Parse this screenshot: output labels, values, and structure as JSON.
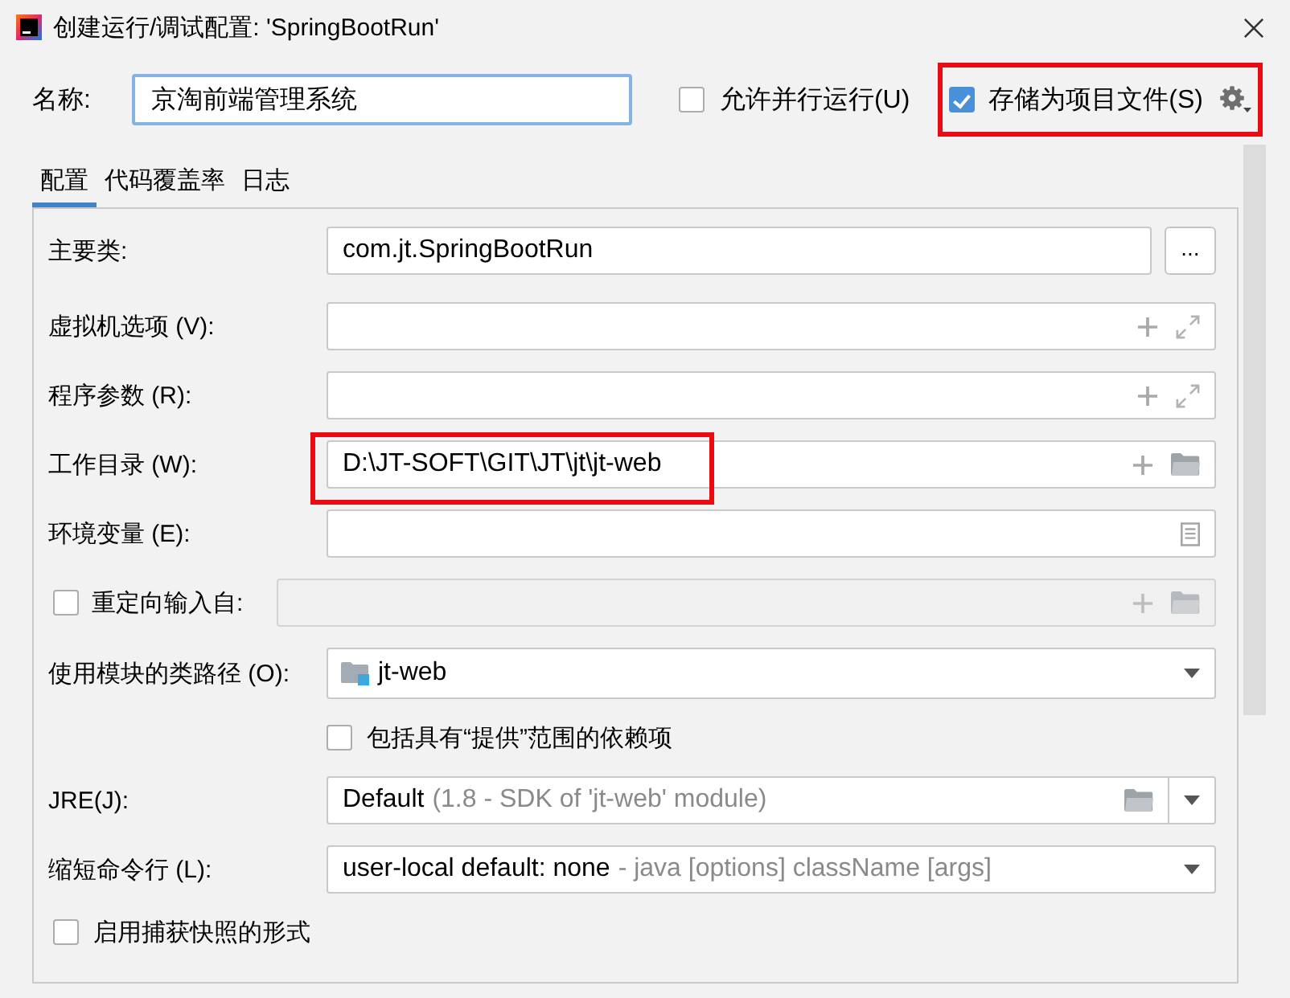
{
  "window": {
    "title": "创建运行/调试配置: 'SpringBootRun'"
  },
  "name_field": {
    "label": "名称:",
    "value": "京淘前端管理系统"
  },
  "options": [
    {
      "label": "允许并行运行(U)",
      "checked": false,
      "highlighted": false
    },
    {
      "label": "存储为项目文件(S)",
      "checked": true,
      "highlighted": true
    }
  ],
  "tabs": [
    {
      "label": "配置",
      "selected": true
    },
    {
      "label": "代码覆盖率",
      "selected": false
    },
    {
      "label": "日志",
      "selected": false
    }
  ],
  "form": [
    {
      "kind": "browse",
      "label": "主要类:",
      "value": "com.jt.SpringBootRun",
      "button": "...",
      "highlighted": false
    },
    {
      "kind": "expandable",
      "label": "虚拟机选项 (V):",
      "highlighted": false
    },
    {
      "kind": "expandable",
      "label": "程序参数 (R):",
      "highlighted": false
    },
    {
      "kind": "path",
      "label": "工作目录 (W):",
      "value": "D:\\JT-SOFT\\GIT\\JT\\jt\\jt-web",
      "highlighted": true
    },
    {
      "kind": "env",
      "label": "环境变量 (E):",
      "highlighted": false
    },
    {
      "kind": "redirect",
      "label": "重定向输入自:",
      "checked": false,
      "highlighted": false
    },
    {
      "kind": "module",
      "label": "使用模块的类路径 (O):",
      "value": "jt-web",
      "highlighted": false
    },
    {
      "kind": "sub_checkbox",
      "label": "包括具有“提供”范围的依赖项",
      "checked": false,
      "highlighted": false
    },
    {
      "kind": "jre",
      "label": "JRE(J):",
      "value": "Default",
      "hint": "(1.8 - SDK of 'jt-web' module)",
      "highlighted": false
    },
    {
      "kind": "select",
      "label": "缩短命令行 (L):",
      "value": "user-local default: none",
      "hint": "- java [options] className [args]",
      "highlighted": false
    },
    {
      "kind": "checkbox",
      "label": "启用捕获快照的形式",
      "checked": false,
      "highlighted": false
    }
  ]
}
